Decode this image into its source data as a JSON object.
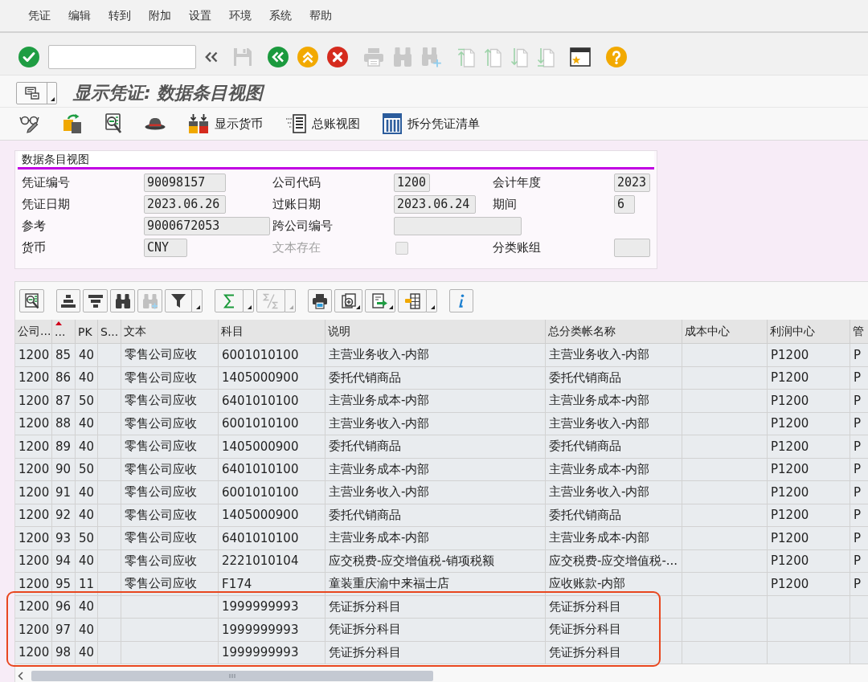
{
  "menu_bar": [
    "凭证",
    "编辑",
    "转到",
    "附加",
    "设置",
    "环境",
    "系统",
    "帮助"
  ],
  "standard_toolbar": [
    [
      {
        "kind": "enter",
        "disabled": false
      },
      {
        "kind": "command_field",
        "disabled": false
      },
      {
        "kind": "toggle",
        "disabled": false
      }
    ],
    [
      {
        "kind": "save",
        "disabled": true
      }
    ],
    [
      {
        "kind": "back",
        "disabled": false
      },
      {
        "kind": "exit",
        "disabled": false
      },
      {
        "kind": "cancel",
        "disabled": false
      }
    ],
    [
      {
        "kind": "print",
        "disabled": true
      },
      {
        "kind": "find",
        "disabled": true
      },
      {
        "kind": "find_next",
        "disabled": true
      }
    ],
    [
      {
        "kind": "first_page",
        "disabled": true
      },
      {
        "kind": "previous_page",
        "disabled": true
      },
      {
        "kind": "next_page",
        "disabled": true
      },
      {
        "kind": "last_page",
        "disabled": true
      }
    ],
    [
      {
        "kind": "new_session",
        "disabled": false
      }
    ],
    [
      {
        "kind": "help",
        "disabled": false
      }
    ]
  ],
  "title": "显示凭证: 数据条目视图",
  "app_toolbar": [
    {
      "kind": "display_change"
    },
    {
      "kind": "other_document"
    },
    {
      "kind": "overview"
    },
    {
      "kind": "services"
    },
    {
      "kind": "currency",
      "label": "显示货币"
    },
    {
      "kind": "ledger_view",
      "label": "总账视图"
    },
    {
      "kind": "split_list",
      "label": "拆分凭证清单"
    }
  ],
  "header": {
    "title": "数据条目视图",
    "rows": [
      [
        {
          "kind": "field",
          "label": "凭证编号",
          "value": "90098157",
          "disabled": false
        },
        {
          "kind": "field",
          "label": "公司代码",
          "value": "1200",
          "disabled": false
        },
        {
          "kind": "field",
          "label": "会计年度",
          "value": "2023",
          "disabled": false
        }
      ],
      [
        {
          "kind": "field",
          "label": "凭证日期",
          "value": "2023.06.26",
          "disabled": false
        },
        {
          "kind": "field",
          "label": "过账日期",
          "value": "2023.06.24",
          "disabled": false
        },
        {
          "kind": "field",
          "label": "期间",
          "value": "6",
          "disabled": false
        }
      ],
      [
        {
          "kind": "field",
          "label": "参考",
          "value": "9000672053",
          "disabled": false
        },
        {
          "kind": "field",
          "label": "跨公司编号",
          "disabled": false
        }
      ],
      [
        {
          "kind": "field",
          "label": "货币",
          "value": "CNY",
          "disabled": false
        },
        {
          "kind": "checkbox",
          "label": "文本存在",
          "checked": false,
          "disabled": true
        },
        {
          "kind": "field",
          "label": "分类账组",
          "disabled": false
        }
      ]
    ]
  },
  "grid": {
    "toolbar": [
      [
        {
          "kind": "details",
          "disabled": false,
          "menu": false
        }
      ],
      [
        {
          "kind": "sort_ascending",
          "disabled": false,
          "menu": false
        },
        {
          "kind": "sort_descending",
          "disabled": false,
          "menu": false
        },
        {
          "kind": "find",
          "disabled": false,
          "menu": false
        },
        {
          "kind": "find_next",
          "disabled": true,
          "menu": false
        },
        {
          "kind": "filter",
          "disabled": false,
          "menu": false
        },
        {
          "kind": "dropdown",
          "disabled": false
        }
      ],
      [
        {
          "kind": "sum",
          "disabled": false,
          "menu": false
        },
        {
          "kind": "dropdown",
          "disabled": false
        },
        {
          "kind": "subtotal",
          "disabled": true,
          "menu": false
        },
        {
          "kind": "dropdown",
          "disabled": true
        }
      ],
      [
        {
          "kind": "print",
          "disabled": false,
          "menu": false
        },
        {
          "kind": "views",
          "disabled": false,
          "menu": true
        },
        {
          "kind": "export",
          "disabled": false,
          "menu": true
        },
        {
          "kind": "layout",
          "disabled": false,
          "menu": false
        },
        {
          "kind": "dropdown",
          "disabled": false
        }
      ],
      [
        {
          "kind": "info",
          "disabled": false,
          "menu": false
        }
      ]
    ],
    "columns": [
      {
        "header": "公司...",
        "sorted": false
      },
      {
        "header": "...",
        "sorted": true
      },
      {
        "header": "PK",
        "sorted": false
      },
      {
        "header": "S...",
        "sorted": false
      },
      {
        "header": "文本",
        "sorted": false
      },
      {
        "header": "科目",
        "sorted": false
      },
      {
        "header": "说明",
        "sorted": false
      },
      {
        "header": "总分类帐名称",
        "sorted": false
      },
      {
        "header": "成本中心",
        "sorted": false
      },
      {
        "header": "利润中心",
        "sorted": false
      },
      {
        "header": "管",
        "sorted": false
      }
    ],
    "rows": [
      {
        "column_1": "1200",
        "column_2": "85",
        "pk": "40",
        "text": "零售公司应收",
        "account": "6001010100",
        "description": "主营业务收入-内部",
        "gl_account_name": "主营业务收入-内部",
        "profit_center": "P1200",
        "column_11": "P",
        "highlighted": false
      },
      {
        "column_1": "1200",
        "column_2": "86",
        "pk": "40",
        "text": "零售公司应收",
        "account": "1405000900",
        "description": "委托代销商品",
        "gl_account_name": "委托代销商品",
        "profit_center": "P1200",
        "column_11": "P",
        "highlighted": false
      },
      {
        "column_1": "1200",
        "column_2": "87",
        "pk": "50",
        "text": "零售公司应收",
        "account": "6401010100",
        "description": "主营业务成本-内部",
        "gl_account_name": "主营业务成本-内部",
        "profit_center": "P1200",
        "column_11": "P",
        "highlighted": false
      },
      {
        "column_1": "1200",
        "column_2": "88",
        "pk": "40",
        "text": "零售公司应收",
        "account": "6001010100",
        "description": "主营业务收入-内部",
        "gl_account_name": "主营业务收入-内部",
        "profit_center": "P1200",
        "column_11": "P",
        "highlighted": false
      },
      {
        "column_1": "1200",
        "column_2": "89",
        "pk": "40",
        "text": "零售公司应收",
        "account": "1405000900",
        "description": "委托代销商品",
        "gl_account_name": "委托代销商品",
        "profit_center": "P1200",
        "column_11": "P",
        "highlighted": false
      },
      {
        "column_1": "1200",
        "column_2": "90",
        "pk": "50",
        "text": "零售公司应收",
        "account": "6401010100",
        "description": "主营业务成本-内部",
        "gl_account_name": "主营业务成本-内部",
        "profit_center": "P1200",
        "column_11": "P",
        "highlighted": false
      },
      {
        "column_1": "1200",
        "column_2": "91",
        "pk": "40",
        "text": "零售公司应收",
        "account": "6001010100",
        "description": "主营业务收入-内部",
        "gl_account_name": "主营业务收入-内部",
        "profit_center": "P1200",
        "column_11": "P",
        "highlighted": false
      },
      {
        "column_1": "1200",
        "column_2": "92",
        "pk": "40",
        "text": "零售公司应收",
        "account": "1405000900",
        "description": "委托代销商品",
        "gl_account_name": "委托代销商品",
        "profit_center": "P1200",
        "column_11": "P",
        "highlighted": false
      },
      {
        "column_1": "1200",
        "column_2": "93",
        "pk": "50",
        "text": "零售公司应收",
        "account": "6401010100",
        "description": "主营业务成本-内部",
        "gl_account_name": "主营业务成本-内部",
        "profit_center": "P1200",
        "column_11": "P",
        "highlighted": false
      },
      {
        "column_1": "1200",
        "column_2": "94",
        "pk": "40",
        "text": "零售公司应收",
        "account": "2221010104",
        "description": "应交税费-应交增值税-销项税额",
        "gl_account_name": "应交税费-应交增值税-...",
        "profit_center": "P1200",
        "column_11": "P",
        "highlighted": false
      },
      {
        "column_1": "1200",
        "column_2": "95",
        "pk": "11",
        "text": "零售公司应收",
        "account": "F174",
        "description": "童装重庆渝中来福士店",
        "gl_account_name": "应收账款-内部",
        "profit_center": "P1200",
        "column_11": "P",
        "highlighted": false
      },
      {
        "column_1": "1200",
        "column_2": "96",
        "pk": "40",
        "account": "1999999993",
        "description": "凭证拆分科目",
        "gl_account_name": "凭证拆分科目",
        "highlighted": true
      },
      {
        "column_1": "1200",
        "column_2": "97",
        "pk": "40",
        "account": "1999999993",
        "description": "凭证拆分科目",
        "gl_account_name": "凭证拆分科目",
        "highlighted": true
      },
      {
        "column_1": "1200",
        "column_2": "98",
        "pk": "40",
        "account": "1999999993",
        "description": "凭证拆分科目",
        "gl_account_name": "凭证拆分科目",
        "highlighted": true
      }
    ]
  }
}
